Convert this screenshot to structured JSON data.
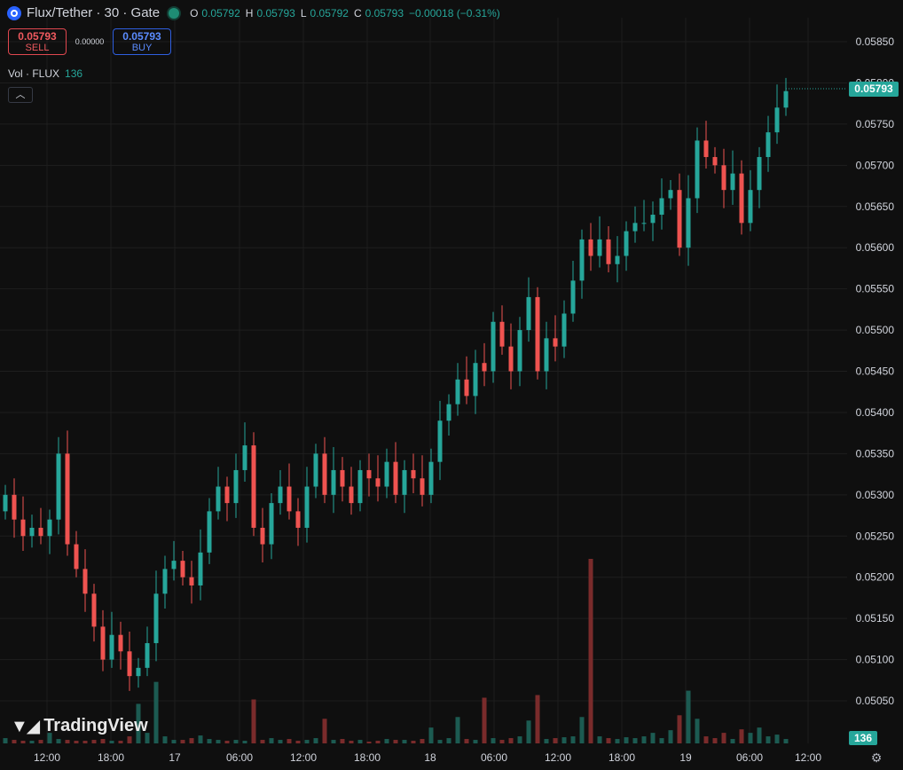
{
  "header": {
    "title": "Flux/Tether · 30 · Gate",
    "ohlc": [
      {
        "k": "O",
        "v": "0.05792"
      },
      {
        "k": "H",
        "v": "0.05793"
      },
      {
        "k": "L",
        "v": "0.05792"
      },
      {
        "k": "C",
        "v": "0.05793"
      }
    ],
    "change": "−0.00018 (−0.31%)"
  },
  "trade": {
    "sell_price": "0.05793",
    "sell_label": "SELL",
    "spread": "0.00000",
    "buy_price": "0.05793",
    "buy_label": "BUY"
  },
  "volume_legend": {
    "label": "Vol · FLUX",
    "value": "136"
  },
  "branding": {
    "text": "TradingView"
  },
  "colors": {
    "up": "#26a69a",
    "down": "#ef5350",
    "grid": "#1e1e1e",
    "axis_text": "#d1d4dc"
  },
  "chart_data": {
    "type": "candlestick",
    "y_axis": {
      "min": 0.05,
      "max": 0.059,
      "ticks": [
        "0.05850",
        "0.05800",
        "0.05750",
        "0.05700",
        "0.05650",
        "0.05600",
        "0.05550",
        "0.05500",
        "0.05450",
        "0.05400",
        "0.05350",
        "0.05300",
        "0.05250",
        "0.05200",
        "0.05150",
        "0.05100",
        "0.05050"
      ]
    },
    "x_axis": {
      "ticks": [
        "12:00",
        "18:00",
        "17",
        "06:00",
        "12:00",
        "18:00",
        "18",
        "06:00",
        "12:00",
        "18:00",
        "19",
        "06:00",
        "12:00"
      ]
    },
    "last_price": "0.05793",
    "last_volume": "136",
    "closes": [
      0.053,
      0.0527,
      0.0525,
      0.0526,
      0.0525,
      0.0527,
      0.0535,
      0.0524,
      0.0521,
      0.0518,
      0.0514,
      0.051,
      0.0513,
      0.0511,
      0.0508,
      0.0509,
      0.0512,
      0.0518,
      0.0521,
      0.0522,
      0.052,
      0.0519,
      0.0523,
      0.0528,
      0.0531,
      0.0529,
      0.0533,
      0.0536,
      0.0526,
      0.0524,
      0.0529,
      0.0531,
      0.0528,
      0.0526,
      0.0531,
      0.0535,
      0.053,
      0.0533,
      0.0531,
      0.0529,
      0.0533,
      0.0532,
      0.0531,
      0.0534,
      0.053,
      0.0533,
      0.0532,
      0.053,
      0.0534,
      0.0539,
      0.0541,
      0.0544,
      0.0542,
      0.0546,
      0.0545,
      0.0551,
      0.0548,
      0.0545,
      0.055,
      0.0554,
      0.0545,
      0.0549,
      0.0548,
      0.0552,
      0.0556,
      0.0561,
      0.0559,
      0.0561,
      0.0558,
      0.0559,
      0.0562,
      0.0563,
      0.0563,
      0.0564,
      0.0566,
      0.0567,
      0.056,
      0.0566,
      0.0573,
      0.0571,
      0.057,
      0.0567,
      0.0569,
      0.0563,
      0.0567,
      0.0571,
      0.0574,
      0.0577,
      0.0579
    ],
    "volumes": [
      6,
      4,
      3,
      3,
      4,
      12,
      5,
      4,
      3,
      3,
      4,
      5,
      3,
      3,
      8,
      45,
      12,
      70,
      8,
      4,
      4,
      6,
      9,
      5,
      4,
      3,
      4,
      3,
      50,
      4,
      6,
      4,
      5,
      3,
      4,
      6,
      28,
      4,
      5,
      3,
      4,
      2,
      3,
      5,
      4,
      4,
      3,
      5,
      18,
      4,
      6,
      30,
      5,
      4,
      52,
      6,
      4,
      6,
      8,
      26,
      55,
      5,
      6,
      7,
      8,
      30,
      210,
      8,
      6,
      5,
      7,
      6,
      8,
      12,
      6,
      15,
      32,
      60,
      28,
      8,
      6,
      12,
      5,
      16,
      12,
      18,
      8,
      10,
      5
    ]
  }
}
